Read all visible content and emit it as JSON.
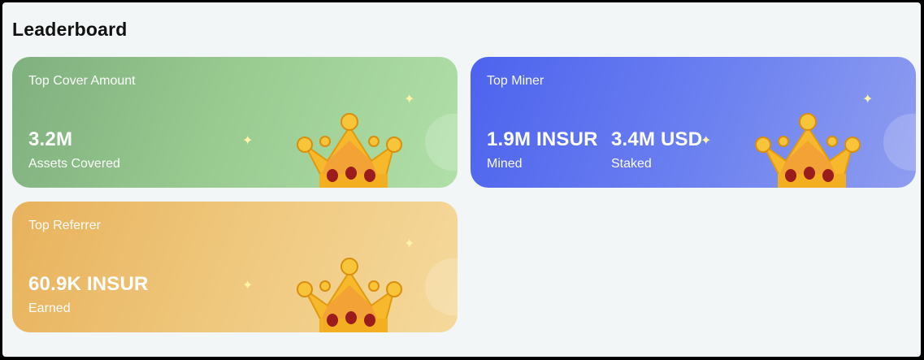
{
  "page": {
    "title": "Leaderboard"
  },
  "cards": [
    {
      "label": "Top Cover Amount",
      "stats": [
        {
          "value": "3.2M",
          "caption": "Assets Covered"
        }
      ]
    },
    {
      "label": "Top Miner",
      "stats": [
        {
          "value": "1.9M INSUR",
          "caption": "Mined"
        },
        {
          "value": "3.4M USD",
          "caption": "Staked"
        }
      ]
    },
    {
      "label": "Top Referrer",
      "stats": [
        {
          "value": "60.9K INSUR",
          "caption": "Earned"
        }
      ]
    }
  ],
  "icons": {
    "crown": "crown-icon",
    "sparkle": "sparkle-icon"
  },
  "colors": {
    "green": "#98c98f",
    "blue": "#5f74f0",
    "orange": "#eec27a",
    "gold": "#f5b829",
    "ruby": "#9b1c1c"
  }
}
